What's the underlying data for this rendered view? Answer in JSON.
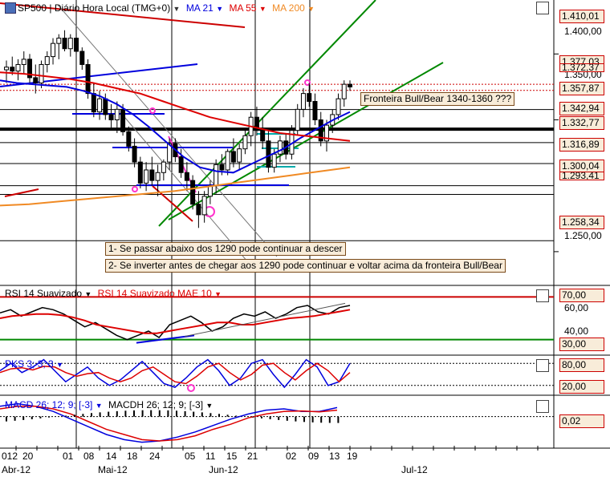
{
  "main_header": {
    "symbol": "SP500",
    "rest": "| Diário Hora Local (TMG+0)",
    "ma21": "MA 21",
    "ma55": "MA 55",
    "ma200": "MA 200"
  },
  "rsi_header": {
    "rsi": "RSI 14 Suavizado",
    "mae": "RSI 14 Suavizado MAE 10"
  },
  "pks_header": {
    "label": "PKS 3; 3; 3"
  },
  "macd_header": {
    "macd": "MACD 26; 12; 9; [-3]",
    "macdh": "MACDH 26; 12; 9; [-3]"
  },
  "annotations": {
    "fronteira": "Fronteira Bull/Bear 1340-1360 ???",
    "note1": "1- Se passar abaixo dos 1290 pode continuar a descer",
    "note2": "2- Se inverter antes de chegar aos 1290 pode continuar e voltar acima da fronteira Bull/Bear"
  },
  "price_axis": {
    "ticks": [
      "1.400,00",
      "1.350,00",
      "1.250,00"
    ],
    "boxes": [
      "1.410,01",
      "1.377,03",
      "1.372,37",
      "1.357,87",
      "1.342,94",
      "1.332,77",
      "1.316,89",
      "1.300,04",
      "1.293,41",
      "1.258,34"
    ]
  },
  "rsi_axis": {
    "ticks": [
      "60,00",
      "40,00"
    ],
    "boxes": [
      "70,00",
      "30,00"
    ]
  },
  "pks_axis": {
    "boxes": [
      "80,00",
      "20,00"
    ]
  },
  "macd_axis": {
    "boxes": [
      "0,02"
    ]
  },
  "x_axis": {
    "days": [
      "012",
      "20",
      "01",
      "08",
      "14",
      "18",
      "24",
      "05",
      "11",
      "15",
      "21",
      "02",
      "09",
      "13",
      "19"
    ],
    "months": [
      "Abr-12",
      "Mai-12",
      "Jun-12",
      "Jul-12"
    ]
  },
  "colors": {
    "ma21": "#0000dd",
    "ma55": "#dd0000",
    "ma200": "#f08a24",
    "channel": "#008800",
    "level": "#000000",
    "rsi": "#000000",
    "rsi_mae": "#dd0000",
    "pks_k": "#0000dd",
    "pks_d": "#dd0000"
  },
  "chart_data": [
    {
      "type": "candlestick",
      "title": "SP500",
      "ylim": [
        1225,
        1430
      ],
      "levels": [
        1377.03,
        1372.37,
        1357.87,
        1342.94,
        1332.77,
        1316.89,
        1300.04,
        1293.41,
        1258.34
      ],
      "candles": [
        [
          1388,
          1395,
          1378,
          1390
        ],
        [
          1390,
          1398,
          1384,
          1387
        ],
        [
          1387,
          1396,
          1380,
          1392
        ],
        [
          1392,
          1402,
          1385,
          1396
        ],
        [
          1396,
          1400,
          1378,
          1382
        ],
        [
          1382,
          1392,
          1370,
          1378
        ],
        [
          1378,
          1395,
          1374,
          1392
        ],
        [
          1392,
          1402,
          1386,
          1398
        ],
        [
          1398,
          1412,
          1392,
          1408
        ],
        [
          1408,
          1415,
          1396,
          1412
        ],
        [
          1412,
          1418,
          1402,
          1404
        ],
        [
          1404,
          1415,
          1398,
          1412
        ],
        [
          1412,
          1416,
          1400,
          1402
        ],
        [
          1402,
          1405,
          1388,
          1392
        ],
        [
          1392,
          1396,
          1366,
          1370
        ],
        [
          1370,
          1378,
          1352,
          1356
        ],
        [
          1356,
          1372,
          1350,
          1366
        ],
        [
          1366,
          1370,
          1350,
          1354
        ],
        [
          1354,
          1362,
          1344,
          1350
        ],
        [
          1350,
          1364,
          1340,
          1358
        ],
        [
          1358,
          1362,
          1338,
          1341
        ],
        [
          1341,
          1345,
          1326,
          1330
        ],
        [
          1330,
          1336,
          1314,
          1318
        ],
        [
          1318,
          1322,
          1298,
          1302
        ],
        [
          1302,
          1318,
          1296,
          1312
        ],
        [
          1312,
          1322,
          1300,
          1304
        ],
        [
          1304,
          1316,
          1292,
          1310
        ],
        [
          1310,
          1320,
          1304,
          1318
        ],
        [
          1318,
          1336,
          1312,
          1332
        ],
        [
          1332,
          1336,
          1318,
          1322
        ],
        [
          1322,
          1328,
          1306,
          1310
        ],
        [
          1310,
          1318,
          1296,
          1304
        ],
        [
          1304,
          1308,
          1282,
          1286
        ],
        [
          1286,
          1296,
          1268,
          1278
        ],
        [
          1278,
          1296,
          1272,
          1292
        ],
        [
          1292,
          1304,
          1286,
          1300
        ],
        [
          1300,
          1320,
          1294,
          1316
        ],
        [
          1316,
          1324,
          1308,
          1312
        ],
        [
          1312,
          1328,
          1308,
          1326
        ],
        [
          1326,
          1336,
          1314,
          1318
        ],
        [
          1318,
          1332,
          1312,
          1328
        ],
        [
          1328,
          1342,
          1324,
          1338
        ],
        [
          1338,
          1356,
          1330,
          1352
        ],
        [
          1352,
          1360,
          1338,
          1342
        ],
        [
          1342,
          1352,
          1328,
          1334
        ],
        [
          1334,
          1342,
          1310,
          1314
        ],
        [
          1314,
          1328,
          1310,
          1324
        ],
        [
          1324,
          1338,
          1318,
          1334
        ],
        [
          1334,
          1340,
          1320,
          1324
        ],
        [
          1324,
          1346,
          1320,
          1342
        ],
        [
          1342,
          1362,
          1338,
          1358
        ],
        [
          1358,
          1374,
          1352,
          1370
        ],
        [
          1370,
          1378,
          1360,
          1364
        ],
        [
          1364,
          1370,
          1346,
          1350
        ],
        [
          1350,
          1356,
          1330,
          1334
        ],
        [
          1334,
          1350,
          1326,
          1346
        ],
        [
          1346,
          1358,
          1340,
          1354
        ],
        [
          1354,
          1370,
          1350,
          1366
        ],
        [
          1366,
          1380,
          1360,
          1377
        ],
        [
          1377,
          1380,
          1372,
          1375
        ]
      ],
      "ma21": [
        1380,
        1378,
        1377,
        1376,
        1375,
        1372,
        1368,
        1362,
        1354,
        1344,
        1333,
        1322,
        1314,
        1311,
        1310,
        1316,
        1322,
        1328,
        1336,
        1343,
        1350,
        1356
      ],
      "ma55": [
        1386,
        1385,
        1383,
        1381,
        1378,
        1374,
        1370,
        1364,
        1358,
        1352,
        1348,
        1344,
        1340,
        1338,
        1336,
        1334
      ],
      "ma200": [
        1285,
        1286,
        1288,
        1290,
        1292,
        1294,
        1296,
        1299,
        1302,
        1305,
        1308,
        1311,
        1314
      ]
    },
    {
      "type": "line",
      "title": "RSI 14 Suavizado",
      "ylim": [
        20,
        80
      ],
      "series": [
        {
          "name": "RSI 14 Suavizado",
          "values": [
            55,
            58,
            52,
            56,
            60,
            58,
            54,
            48,
            42,
            46,
            40,
            34,
            30,
            34,
            38,
            32,
            44,
            48,
            52,
            46,
            38,
            42,
            50,
            54,
            52,
            56,
            50,
            54,
            60,
            62,
            56,
            54,
            60,
            62
          ]
        },
        {
          "name": "RSI 14 Suavizado MAE 10",
          "values": [
            50,
            52,
            53,
            54,
            54,
            53,
            51,
            48,
            44,
            42,
            40,
            38,
            36,
            36,
            38,
            40,
            42,
            44,
            46,
            46,
            44,
            44,
            46,
            48,
            50,
            51,
            52,
            54,
            56,
            58
          ]
        }
      ]
    },
    {
      "type": "line",
      "title": "PKS 3; 3; 3",
      "ylim": [
        0,
        100
      ],
      "series": [
        {
          "name": "K",
          "values": [
            60,
            80,
            55,
            70,
            90,
            60,
            30,
            50,
            70,
            40,
            20,
            35,
            60,
            85,
            55,
            25,
            15,
            40,
            70,
            90,
            60,
            20,
            40,
            80,
            90,
            50,
            15,
            50,
            90,
            70,
            20,
            30,
            80
          ]
        },
        {
          "name": "D",
          "values": [
            55,
            65,
            68,
            62,
            72,
            70,
            55,
            45,
            52,
            55,
            40,
            30,
            40,
            60,
            70,
            50,
            30,
            25,
            45,
            70,
            80,
            55,
            35,
            50,
            75,
            80,
            55,
            35,
            60,
            80,
            60,
            30,
            55
          ]
        }
      ]
    },
    {
      "type": "line",
      "title": "MACD 26; 12; 9; [-3]",
      "series": [
        {
          "name": "MACD 26; 12; 9; [-3]",
          "values": [
            0.4,
            0.5,
            0.4,
            0.2,
            -0.1,
            -0.4,
            -0.7,
            -0.9,
            -1,
            -0.95,
            -0.8,
            -0.6,
            -0.35,
            -0.1,
            0.1,
            0.25,
            0.3,
            0.2,
            0.2,
            0.35
          ]
        },
        {
          "name": "MACDH 26; 12; 9; [-3]",
          "values": [
            0.3,
            0.4,
            0.4,
            0.3,
            0.1,
            -0.2,
            -0.5,
            -0.7,
            -0.9,
            -0.95,
            -0.9,
            -0.75,
            -0.5,
            -0.3,
            -0.05,
            0.1,
            0.2,
            0.22,
            0.18,
            0.25
          ]
        }
      ]
    }
  ]
}
